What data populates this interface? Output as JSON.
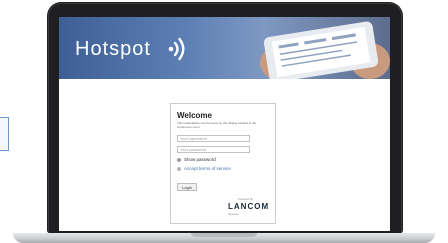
{
  "hero": {
    "title": "Hotspot"
  },
  "login": {
    "welcome": "Welcome",
    "intro": "This marketplace can be found on the display located in the conference room.",
    "username_placeholder": "Your username",
    "password_placeholder": "Your password",
    "show_password_label": "Show password",
    "terms_label": "Accept terms of service",
    "login_button": "Login",
    "powered_by": "Powered By",
    "brand": "LANCOM",
    "brand_sub": "Systems"
  },
  "colors": {
    "banner_start": "#3d5f95",
    "banner_end": "#7e98c2",
    "link": "#3d6fb0",
    "bezel": "#1f1f21"
  },
  "icons": [
    "wifi-signal-icon",
    "phone-icon"
  ]
}
